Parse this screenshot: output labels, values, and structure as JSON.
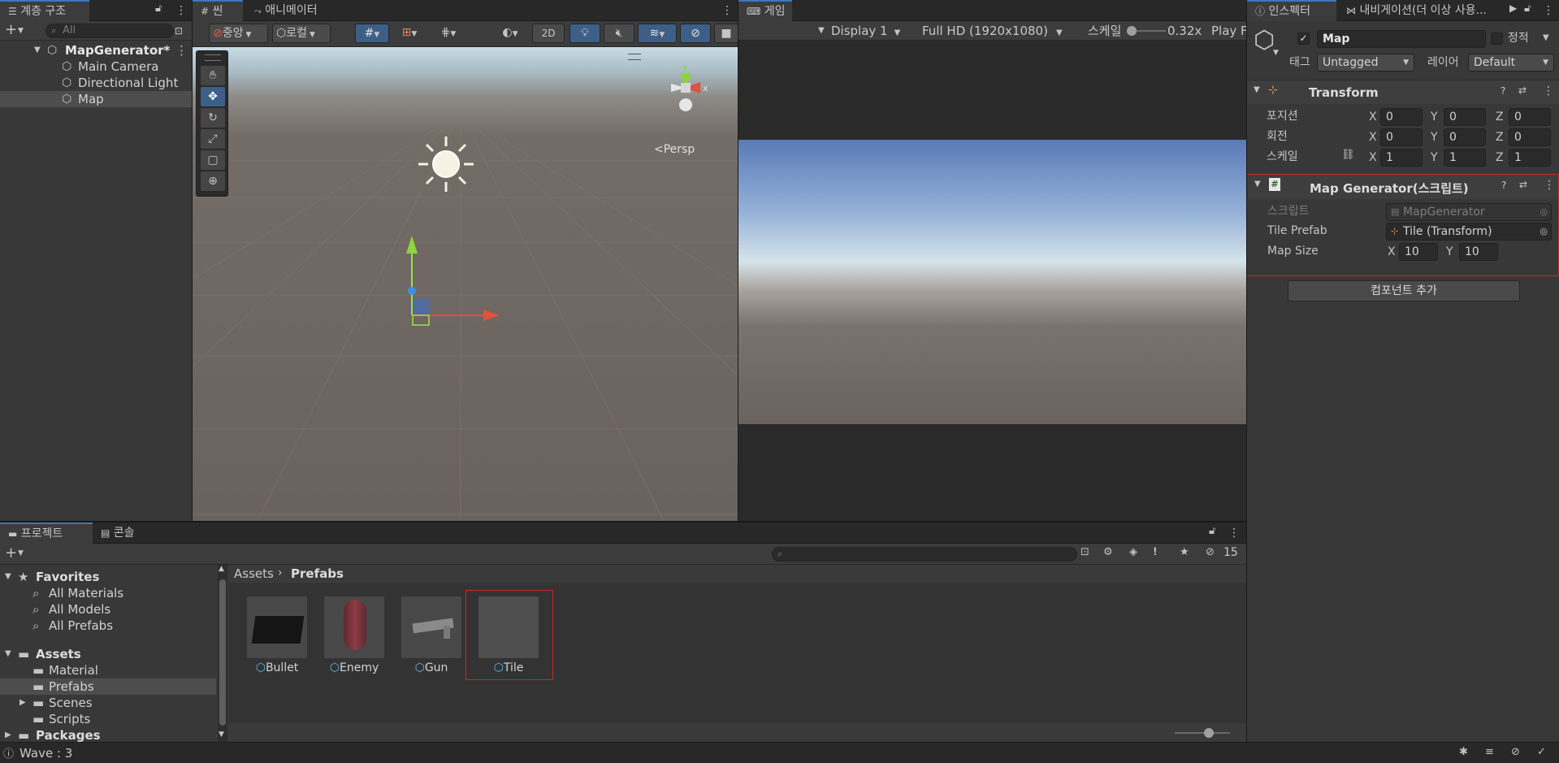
{
  "hierarchy": {
    "tab_label": "계층 구조",
    "search_placeholder": "All",
    "scene_name": "MapGenerator*",
    "items": [
      "Main Camera",
      "Directional Light",
      "Map"
    ]
  },
  "scene_view": {
    "tabs": [
      "씬",
      "애니메이터"
    ],
    "pivot_label": "중앙",
    "space_label": "로컬",
    "mode_2d": "2D",
    "persp_label": "Persp",
    "gizmo_y": "y",
    "gizmo_x": "x"
  },
  "game_view": {
    "tab_label": "게임",
    "display": "Display 1",
    "resolution": "Full HD (1920x1080)",
    "scale_label": "스케일",
    "scale_value": "0.32x",
    "play_label": "Play F"
  },
  "inspector": {
    "tabs": [
      "인스펙터",
      "내비게이션(더 이상 사용..."
    ],
    "object_name": "Map",
    "static_label": "정적",
    "tag_label": "태그",
    "tag_value": "Untagged",
    "layer_label": "레이어",
    "layer_value": "Default",
    "transform": {
      "title": "Transform",
      "position_label": "포지션",
      "rotation_label": "회전",
      "scale_label": "스케일",
      "position": [
        "0",
        "0",
        "0"
      ],
      "rotation": [
        "0",
        "0",
        "0"
      ],
      "scale": [
        "1",
        "1",
        "1"
      ]
    },
    "map_generator": {
      "title": "Map Generator(스크립트)",
      "script_label": "스크립트",
      "script_value": "MapGenerator",
      "tile_prefab_label": "Tile Prefab",
      "tile_prefab_value": "Tile (Transform)",
      "map_size_label": "Map Size",
      "map_size_x": "10",
      "map_size_y": "10"
    },
    "add_component_label": "컴포넌트 추가",
    "axis_x": "X",
    "axis_y": "Y",
    "axis_z": "Z"
  },
  "project": {
    "tabs": [
      "프로젝트",
      "콘솔"
    ],
    "hidden_count": "15",
    "tree": {
      "favorites_label": "Favorites",
      "favorites": [
        "All Materials",
        "All Models",
        "All Prefabs"
      ],
      "assets_label": "Assets",
      "assets": [
        "Material",
        "Prefabs",
        "Scenes",
        "Scripts"
      ],
      "packages_label": "Packages"
    },
    "breadcrumb": [
      "Assets",
      "Prefabs"
    ],
    "assets_grid": [
      "Bullet",
      "Enemy",
      "Gun",
      "Tile"
    ],
    "selected_asset": "Tile"
  },
  "status_bar": {
    "message": "Wave : 3"
  },
  "colors": {
    "accent": "#3a79bb",
    "highlight_box": "#c62828"
  }
}
